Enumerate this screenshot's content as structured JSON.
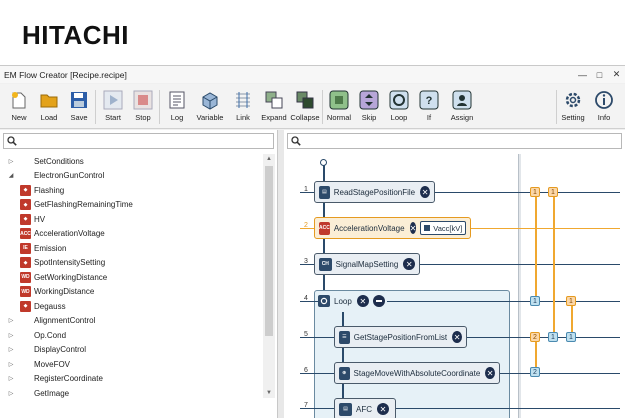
{
  "brand": {
    "logo_text": "HITACHI"
  },
  "window": {
    "title": "EM Flow Creator  [Recipe.recipe]"
  },
  "toolbar": {
    "buttons": [
      {
        "id": "new",
        "label": "New"
      },
      {
        "id": "load",
        "label": "Load"
      },
      {
        "id": "save",
        "label": "Save"
      },
      {
        "id": "start",
        "label": "Start"
      },
      {
        "id": "stop",
        "label": "Stop"
      },
      {
        "id": "log",
        "label": "Log"
      },
      {
        "id": "variable",
        "label": "Variable"
      },
      {
        "id": "link",
        "label": "Link"
      },
      {
        "id": "expand",
        "label": "Expand"
      },
      {
        "id": "collapse",
        "label": "Collapse"
      },
      {
        "id": "normal",
        "label": "Normal"
      },
      {
        "id": "skip",
        "label": "Skip"
      },
      {
        "id": "loop",
        "label": "Loop"
      },
      {
        "id": "if",
        "label": "If"
      },
      {
        "id": "assign",
        "label": "Assign"
      },
      {
        "id": "setting",
        "label": "Setting"
      },
      {
        "id": "info",
        "label": "Info"
      }
    ]
  },
  "tree": {
    "items": [
      {
        "label": "SetConditions",
        "level": 0,
        "expander": "collapsed"
      },
      {
        "label": "ElectronGunControl",
        "level": 0,
        "expander": "expanded"
      },
      {
        "label": "Flashing",
        "level": 1,
        "icon": "flash-icon",
        "icon_text": "",
        "icon_color": "#c0392b"
      },
      {
        "label": "GetFlashingRemainingTime",
        "level": 1,
        "icon": "flash-timer-icon",
        "icon_text": "",
        "icon_color": "#c0392b"
      },
      {
        "label": "HV",
        "level": 1,
        "icon": "hv-icon",
        "icon_text": "",
        "icon_color": "#c0392b"
      },
      {
        "label": "AccelerationVoltage",
        "level": 1,
        "icon": "acc-voltage-icon",
        "icon_text": "ACC",
        "icon_color": "#c0392b"
      },
      {
        "label": "Emission",
        "level": 1,
        "icon": "emission-icon",
        "icon_text": "IE",
        "icon_color": "#c0392b"
      },
      {
        "label": "SpotIntensitySetting",
        "level": 1,
        "icon": "spot-icon",
        "icon_text": "",
        "icon_color": "#c0392b"
      },
      {
        "label": "GetWorkingDistance",
        "level": 1,
        "icon": "wd-icon",
        "icon_text": "WD",
        "icon_color": "#c0392b"
      },
      {
        "label": "WorkingDistance",
        "level": 1,
        "icon": "wd-icon",
        "icon_text": "WD",
        "icon_color": "#c0392b"
      },
      {
        "label": "Degauss",
        "level": 1,
        "icon": "degauss-icon",
        "icon_text": "",
        "icon_color": "#c0392b"
      },
      {
        "label": "AlignmentControl",
        "level": 0,
        "expander": "collapsed"
      },
      {
        "label": "Op.Cond",
        "level": 0,
        "expander": "collapsed"
      },
      {
        "label": "DisplayControl",
        "level": 0,
        "expander": "collapsed"
      },
      {
        "label": "MoveFOV",
        "level": 0,
        "expander": "collapsed"
      },
      {
        "label": "RegisterCoordinate",
        "level": 0,
        "expander": "collapsed"
      },
      {
        "label": "GetImage",
        "level": 0,
        "expander": "collapsed"
      }
    ]
  },
  "flow": {
    "rows": [
      {
        "num": "1",
        "label": "ReadStagePositionFile",
        "icon": "file-read-icon"
      },
      {
        "num": "2",
        "label": "AccelerationVoltage",
        "icon": "acc-voltage-icon",
        "var": "Vacc[kV]"
      },
      {
        "num": "3",
        "label": "SignalMapSetting",
        "icon": "signal-map-icon"
      },
      {
        "num": "4",
        "label": "Loop",
        "icon": "loop-icon"
      },
      {
        "num": "5",
        "label": "GetStagePositionFromList",
        "icon": "stage-list-icon"
      },
      {
        "num": "6",
        "label": "StageMoveWithAbsoluteCoordinate",
        "icon": "stage-move-icon"
      },
      {
        "num": "7",
        "label": "AFC",
        "icon": "afc-icon"
      }
    ],
    "badges": {
      "b1": "1",
      "b2": "2"
    }
  },
  "colors": {
    "accent_orange": "#f0a830",
    "node_border": "#4a5a6a",
    "line_dark": "#2a4a6a",
    "flow_badge": "#7fb7d8"
  }
}
